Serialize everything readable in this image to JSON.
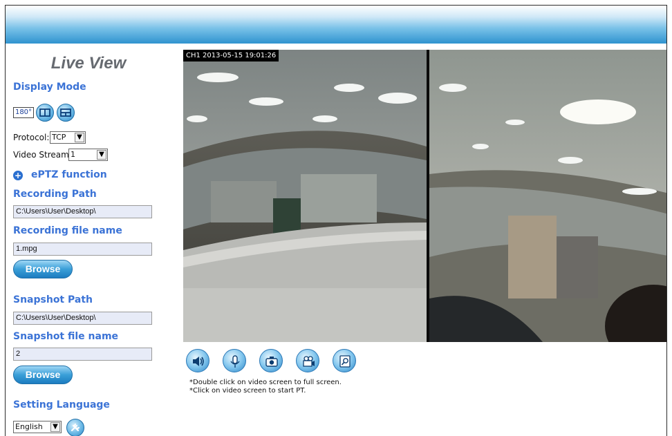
{
  "sidebar": {
    "title": "Live View",
    "display_mode_heading": "Display Mode",
    "display_mode_buttons": [
      "180°",
      "split-view-icon",
      "quad-view-icon"
    ],
    "protocol_label": "Protocol:",
    "protocol_value": "TCP",
    "video_stream_label": "Video Stream:",
    "video_stream_value": "1",
    "eptz_label": "ePTZ function",
    "recording_path_heading": "Recording Path",
    "recording_path_value": "C:\\Users\\User\\Desktop\\",
    "recording_file_heading": "Recording file name",
    "recording_file_value": "1.mpg",
    "browse_label": "Browse",
    "snapshot_path_heading": "Snapshot Path",
    "snapshot_path_value": "C:\\Users\\User\\Desktop\\",
    "snapshot_file_heading": "Snapshot file name",
    "snapshot_file_value": "2",
    "language_heading": "Setting Language",
    "language_value": "English"
  },
  "video": {
    "overlay": "CH1 2013-05-15 19:01:26"
  },
  "controls": {
    "icons": [
      "speaker-icon",
      "microphone-icon",
      "camera-snapshot-icon",
      "video-record-icon",
      "zoom-search-icon"
    ]
  },
  "notes": {
    "line1": "*Double click on video screen to full screen.",
    "line2": "*Click on video screen to start PT."
  },
  "colors": {
    "heading": "#3b73d6",
    "button_blue": "#2c86c6",
    "header_bar": "#2f93cf"
  }
}
